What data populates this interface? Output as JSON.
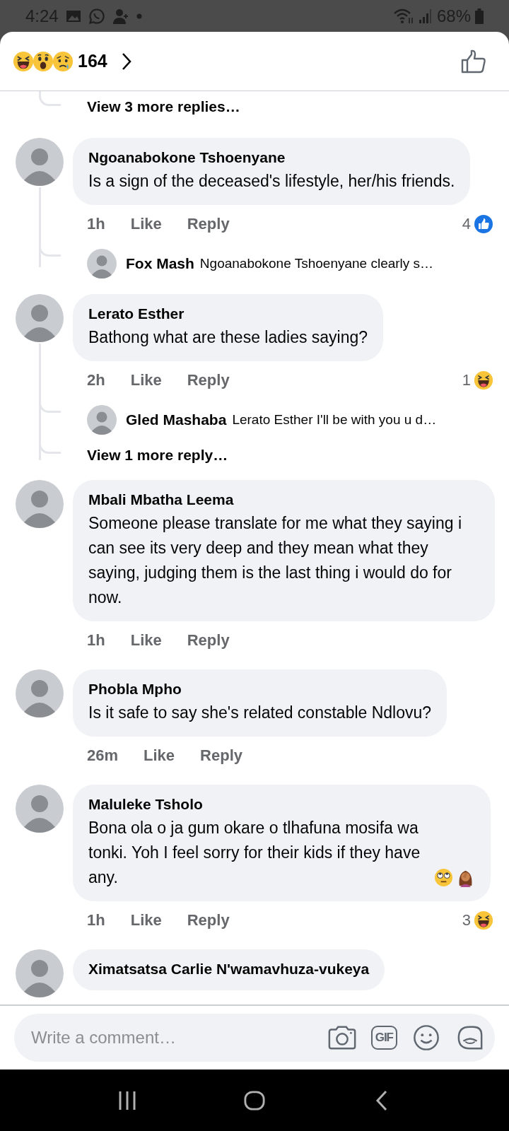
{
  "status_bar": {
    "time": "4:24",
    "battery": "68%"
  },
  "header": {
    "reactions": [
      {
        "kind": "haha"
      },
      {
        "kind": "wow"
      },
      {
        "kind": "sad"
      }
    ],
    "count": "164"
  },
  "top_more": {
    "text": "View 3 more replies…"
  },
  "comments": [
    {
      "author": "Ngoanabokone Tshoenyane",
      "text": "Is a sign of the deceased's lifestyle, her/his friends.",
      "time": "1h",
      "like": "Like",
      "reply": "Reply",
      "reaction": {
        "count": "4",
        "kind": "like"
      },
      "replies": [
        {
          "author": "Fox Mash",
          "text": "Ngoanabokone Tshoenyane clearly s…"
        }
      ]
    },
    {
      "author": "Lerato Esther",
      "text": "Bathong what are these ladies saying?",
      "time": "2h",
      "like": "Like",
      "reply": "Reply",
      "reaction": {
        "count": "1",
        "kind": "haha"
      },
      "replies": [
        {
          "author": "Gled Mashaba",
          "text": "Lerato Esther I'll be with you u d…"
        }
      ],
      "more": "View 1 more reply…"
    },
    {
      "author": "Mbali Mbatha Leema",
      "text": "Someone please translate for me what they saying i can see its very deep and they mean what they saying, judging them is the last thing i would do for now.",
      "time": "1h",
      "like": "Like",
      "reply": "Reply"
    },
    {
      "author": "Phobla Mpho",
      "text": "Is it safe to say she's related constable Ndlovu?",
      "time": "26m",
      "like": "Like",
      "reply": "Reply"
    },
    {
      "author": "Maluleke Tsholo",
      "text": "Bona ola o ja gum okare o tlhafuna mosifa wa tonki.  Yoh I feel sorry for their kids if they have any.",
      "trailing_emoji": [
        {
          "kind": "eye_roll"
        },
        {
          "kind": "facepalm"
        }
      ],
      "time": "1h",
      "like": "Like",
      "reply": "Reply",
      "reaction": {
        "count": "3",
        "kind": "haha"
      }
    },
    {
      "author": "Ximatsatsa Carlie N'wamavhuza-vukeya"
    }
  ],
  "composer": {
    "placeholder": "Write a comment…",
    "gif_label": "GIF"
  }
}
